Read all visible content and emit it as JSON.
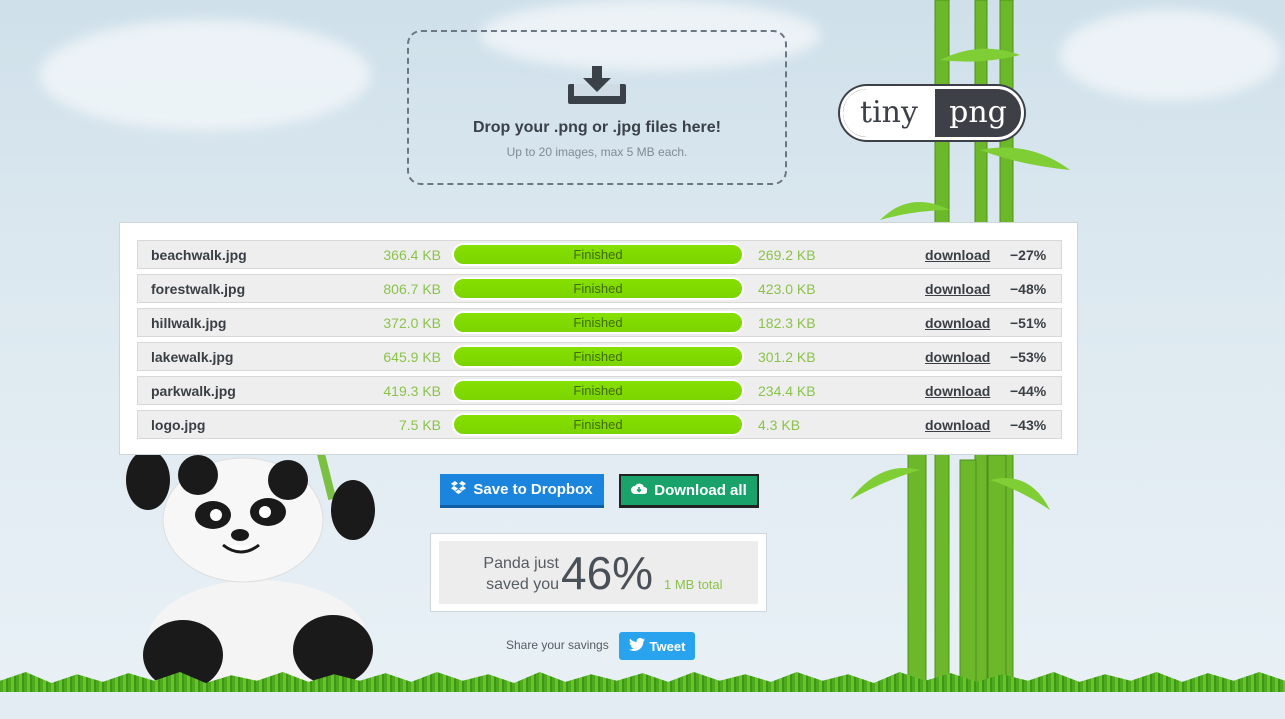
{
  "dropzone": {
    "icon": "download-tray-icon",
    "title": "Drop your .png or .jpg files here!",
    "subtitle": "Up to 20 images, max 5 MB each."
  },
  "logo": {
    "part1": "tiny",
    "part2": "png"
  },
  "files": [
    {
      "name": "beachwalk.jpg",
      "original": "366.4 KB",
      "status": "Finished",
      "compressed": "269.2 KB",
      "download": "download",
      "saving": "−27%"
    },
    {
      "name": "forestwalk.jpg",
      "original": "806.7 KB",
      "status": "Finished",
      "compressed": "423.0 KB",
      "download": "download",
      "saving": "−48%"
    },
    {
      "name": "hillwalk.jpg",
      "original": "372.0 KB",
      "status": "Finished",
      "compressed": "182.3 KB",
      "download": "download",
      "saving": "−51%"
    },
    {
      "name": "lakewalk.jpg",
      "original": "645.9 KB",
      "status": "Finished",
      "compressed": "301.2 KB",
      "download": "download",
      "saving": "−53%"
    },
    {
      "name": "parkwalk.jpg",
      "original": "419.3 KB",
      "status": "Finished",
      "compressed": "234.4 KB",
      "download": "download",
      "saving": "−44%"
    },
    {
      "name": "logo.jpg",
      "original": "7.5 KB",
      "status": "Finished",
      "compressed": "4.3 KB",
      "download": "download",
      "saving": "−43%"
    }
  ],
  "buttons": {
    "dropbox": "Save to Dropbox",
    "dropbox_icon": "dropbox-icon",
    "download_all": "Download all",
    "download_all_icon": "cloud-download-icon"
  },
  "savings": {
    "text": "Panda just saved you",
    "percent": "46%",
    "total": "1 MB total"
  },
  "share": {
    "label": "Share your savings",
    "tweet": "Tweet",
    "tweet_icon": "twitter-bird-icon"
  },
  "colors": {
    "progress": "#86e000",
    "dropbox": "#1b84dc",
    "download_all": "#19a36b",
    "tweet": "#2aa3ef",
    "size_text": "#8bc34a"
  }
}
